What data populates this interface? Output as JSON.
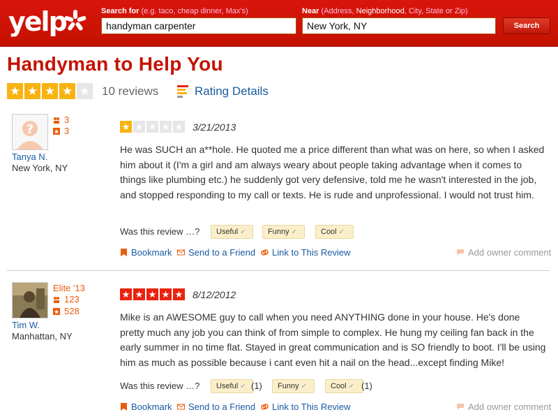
{
  "header": {
    "logo_text": "yelp",
    "search_for_label": "Search for",
    "search_for_hint": "(e.g. taco, cheap dinner, Max's)",
    "search_value": "handyman carpenter",
    "near_label": "Near",
    "near_hint_prefix": "(Address, ",
    "near_hint_link": "Neighborhood",
    "near_hint_suffix": ", City, State or Zip)",
    "near_value": "New York, NY",
    "search_button": "Search",
    "brand_color": "#c41200"
  },
  "business": {
    "title": "Handyman to Help You",
    "rating": 4,
    "max_rating": 5,
    "review_count_text": "10 reviews",
    "rating_details_label": "Rating Details"
  },
  "reviews": [
    {
      "user_name": "Tanya N.",
      "location": "New York, NY",
      "elite": "",
      "friends": "3",
      "reviews": "3",
      "avatar": "default-avatar-icon",
      "rating": 1,
      "date": "3/21/2013",
      "text": "He was SUCH an a**hole.  He quoted me a price different than what was on here, so when I asked him about it (I'm a girl and am always weary about people taking advantage when it comes to things like plumbing etc.) he suddenly got very defensive, told me he wasn't interested in the job, and stopped responding to my call or texts.  He is rude and unprofessional.  I would not trust him.",
      "vote_question": "Was this review …?",
      "useful": "Useful",
      "funny": "Funny",
      "cool": "Cool",
      "useful_count": "",
      "funny_count": "",
      "cool_count": "",
      "bookmark": "Bookmark",
      "send": "Send to a Friend",
      "link": "Link to This Review",
      "owner_comment": "Add owner comment"
    },
    {
      "user_name": "Tim W.",
      "location": "Manhattan, NY",
      "elite": "Elite '13",
      "friends": "123",
      "reviews": "528",
      "avatar": "user-photo",
      "rating": 5,
      "date": "8/12/2012",
      "text": "Mike is an AWESOME guy to call when you need ANYTHING done in your house.  He's done pretty much any job you can think of from simple to complex.  He hung my ceiling fan back in the early summer in no time flat.  Stayed in great communication and is SO friendly to boot.  I'll be using him as much as possible because i cant even hit a nail on the head...except finding Mike!",
      "vote_question": "Was this review …?",
      "useful": "Useful",
      "funny": "Funny",
      "cool": "Cool",
      "useful_count": "(1)",
      "funny_count": "",
      "cool_count": "(1)",
      "bookmark": "Bookmark",
      "send": "Send to a Friend",
      "link": "Link to This Review",
      "owner_comment": "Add owner comment"
    }
  ],
  "colors": {
    "star_yellow": "#f8b311",
    "star_red": "#e9230d",
    "link_blue": "#1a5aa0",
    "stat_orange": "#e85c0d"
  }
}
